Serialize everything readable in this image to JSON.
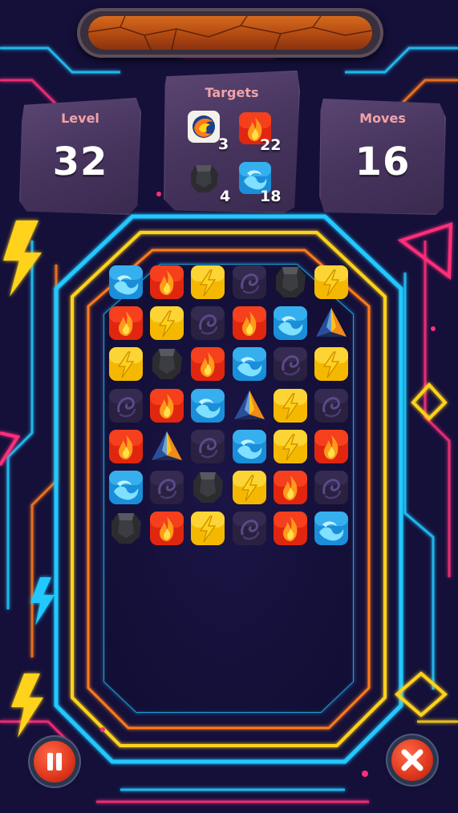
{
  "hud": {
    "level": {
      "label": "Level",
      "value": "32"
    },
    "moves": {
      "label": "Moves",
      "value": "16"
    },
    "targets": {
      "label": "Targets",
      "items": [
        {
          "icon": "fire-orb-icon",
          "count": "3"
        },
        {
          "icon": "fire-gem-icon",
          "count": "22"
        },
        {
          "icon": "stone-gem-icon",
          "count": "4"
        },
        {
          "icon": "water-gem-icon",
          "count": "18"
        }
      ]
    }
  },
  "board": {
    "rows": 7,
    "cols": 6,
    "tiles": [
      [
        "water",
        "fire",
        "lightning",
        "dark",
        "stone",
        "lightning"
      ],
      [
        "fire",
        "lightning",
        "dark",
        "fire",
        "water",
        "pyramid"
      ],
      [
        "lightning",
        "stone",
        "fire",
        "water",
        "dark",
        "lightning"
      ],
      [
        "dark",
        "fire",
        "water",
        "pyramid",
        "lightning",
        "dark"
      ],
      [
        "fire",
        "pyramid",
        "dark",
        "water",
        "lightning",
        "fire"
      ],
      [
        "water",
        "dark",
        "stone",
        "lightning",
        "fire",
        "dark"
      ],
      [
        "stone",
        "fire",
        "lightning",
        "dark",
        "fire",
        "water"
      ]
    ]
  },
  "controls": {
    "pause": {
      "icon": "pause-icon"
    },
    "close": {
      "icon": "close-icon"
    }
  },
  "colors": {
    "background": "#14103a",
    "neon_pink": "#ff2f7a",
    "neon_cyan": "#23c8ff",
    "neon_yellow": "#ffd21a",
    "neon_orange": "#ff7a1a",
    "panel_stone": "#4a3760",
    "label_pink": "#f2a3a8"
  }
}
